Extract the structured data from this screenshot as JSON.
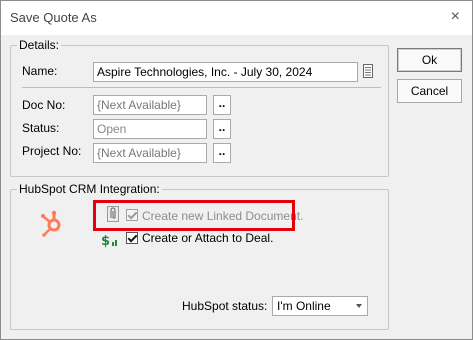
{
  "window": {
    "title": "Save Quote As",
    "close_glyph": "×"
  },
  "details": {
    "legend": "Details:",
    "name_label": "Name:",
    "name_value": "Aspire Technologies, Inc. - July 30, 2024",
    "doc_no_label": "Doc No:",
    "doc_no_value": "{Next Available}",
    "status_label": "Status:",
    "status_value": "Open",
    "project_no_label": "Project No:",
    "project_no_value": "{Next Available}",
    "ellipsis": ".."
  },
  "buttons": {
    "ok_label": "Ok",
    "cancel_label": "Cancel"
  },
  "hubspot": {
    "legend": "HubSpot CRM Integration:",
    "create_linked_label": "Create new Linked Document.",
    "create_linked_checked": true,
    "create_linked_enabled": false,
    "create_deal_label": "Create or Attach to Deal.",
    "create_deal_checked": true,
    "status_label": "HubSpot status:",
    "status_value": "I'm Online"
  },
  "icons": {
    "hubspot_logo": "hubspot-sprocket-icon",
    "paperclip": "paperclip-icon",
    "deal": "dollar-chart-icon",
    "notes": "notepad-icon"
  },
  "colors": {
    "hubspot_orange": "#ff7a59",
    "highlight_red": "#e4000f",
    "deal_green": "#1f8a3a"
  }
}
